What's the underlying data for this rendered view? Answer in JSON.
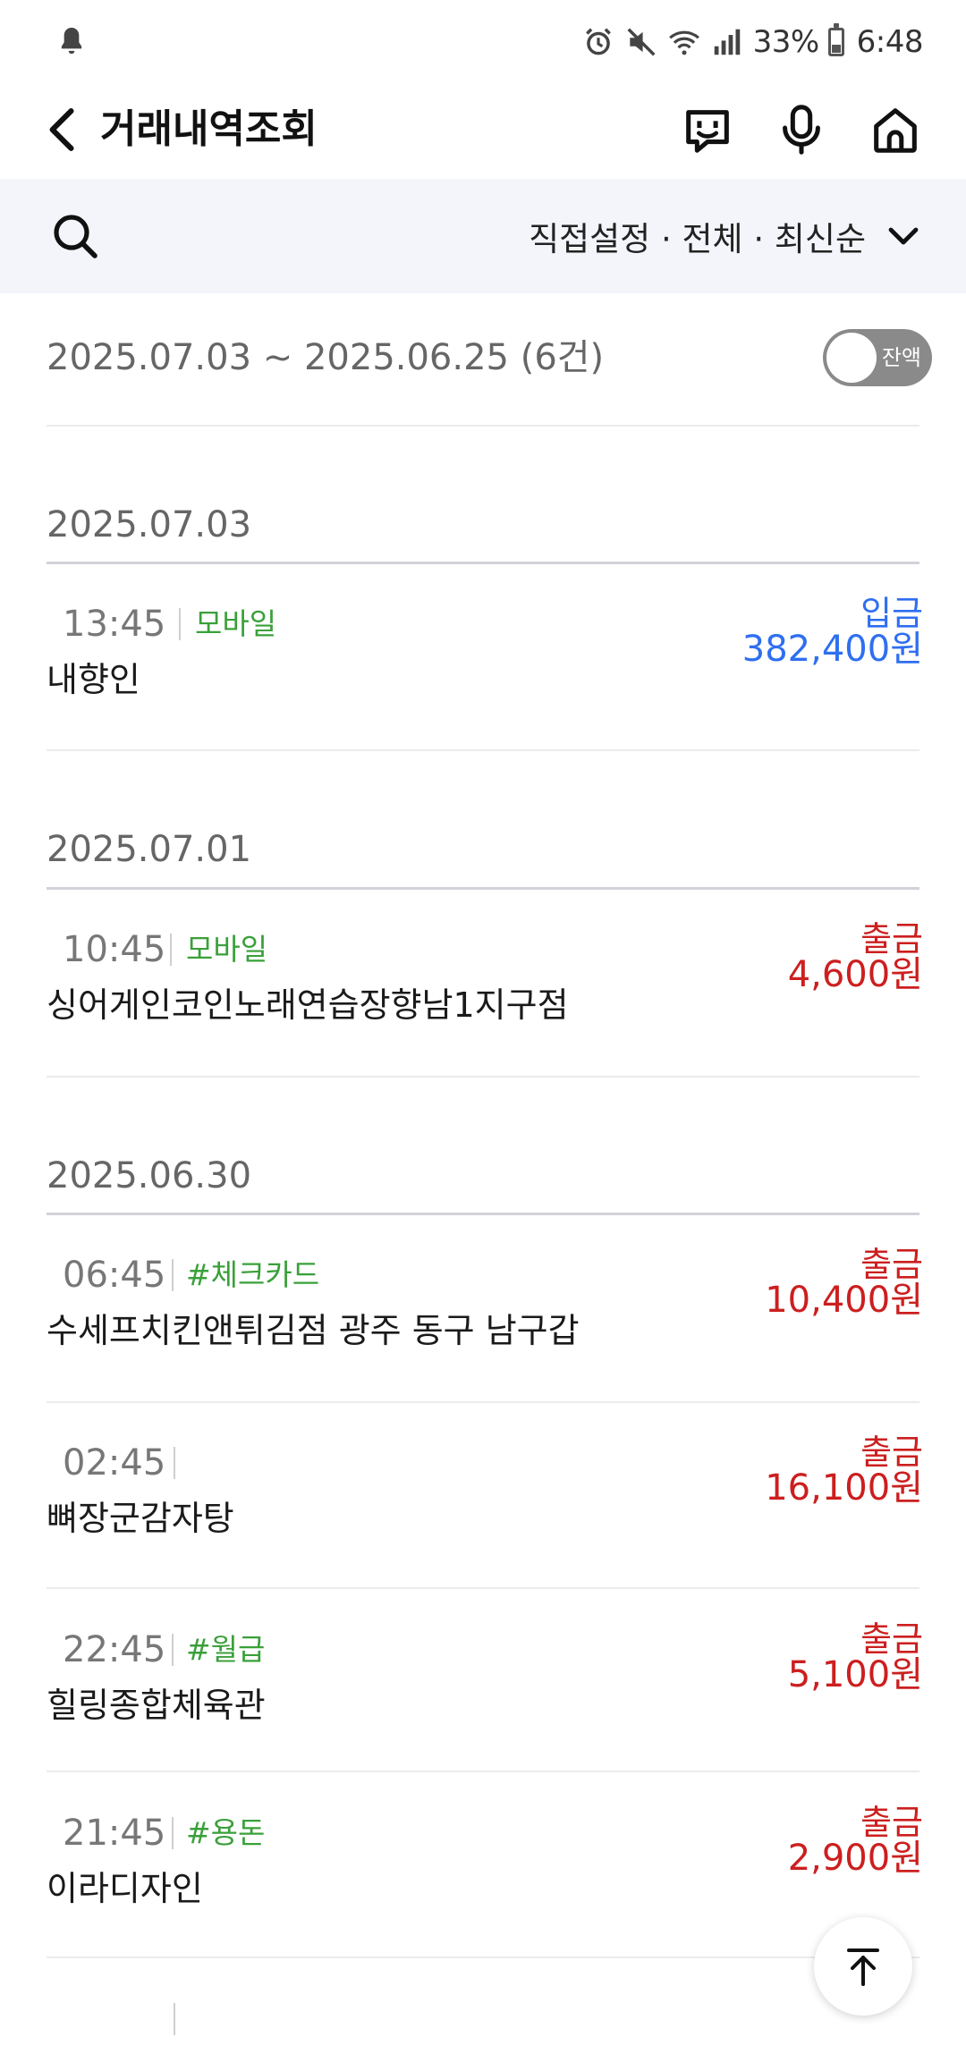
{
  "status_bar": {
    "battery": "33%",
    "battery_level": 0.33,
    "time": "6:48"
  },
  "header": {
    "title": "거래내역조회"
  },
  "filter": {
    "label": "직접설정 · 전체 · 최신순"
  },
  "summary": {
    "range": "2025.07.03 ~ 2025.06.25 (6건)",
    "balance_toggle_label": "잔액"
  },
  "groups": [
    {
      "date": "2025.07.03",
      "transactions": [
        {
          "time": "13:45",
          "tag": "모바일",
          "merchant": "내향인",
          "type": "입금",
          "amount": "382,400원"
        }
      ]
    },
    {
      "date": "2025.07.01",
      "transactions": [
        {
          "time": "10:45",
          "tag": "모바일",
          "merchant": "싱어게인코인노래연습장향남1지구점",
          "type": "출금",
          "amount": "4,600원"
        }
      ]
    },
    {
      "date": "2025.06.30",
      "transactions": [
        {
          "time": "06:45",
          "tag": "#체크카드",
          "merchant": "수세프치킨앤튀김점 광주 동구 남구갑",
          "type": "출금",
          "amount": "10,400원"
        },
        {
          "time": "02:45",
          "tag": "",
          "merchant": "뼈장군감자탕",
          "type": "출금",
          "amount": "16,100원"
        },
        {
          "time": "22:45",
          "tag": "#월급",
          "merchant": "힐링종합체육관",
          "type": "출금",
          "amount": "5,100원"
        },
        {
          "time": "21:45",
          "tag": "#용돈",
          "merchant": "이라디자인",
          "type": "출금",
          "amount": "2,900원"
        }
      ]
    }
  ],
  "colors": {
    "deposit": "#2f6ff0",
    "withdrawal": "#cc1f1f",
    "tag": "#3aa03a"
  }
}
